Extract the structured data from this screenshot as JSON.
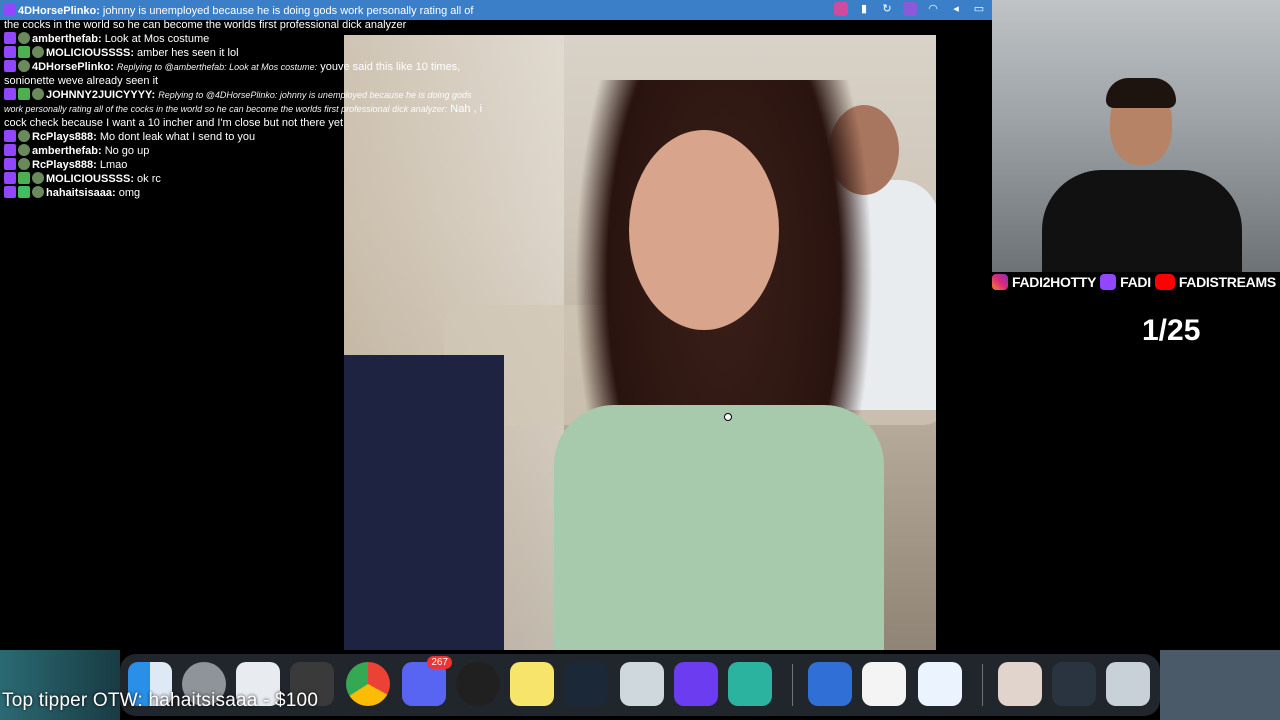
{
  "chat": {
    "messages": [
      {
        "user": "4DHorsePlinko:",
        "reply": "",
        "text": "johnny is unemployed because he is doing gods work personally rating all of the cocks in the world so he can become the worlds first professional dick analyzer"
      },
      {
        "user": "amberthefab:",
        "reply": "",
        "text": "Look at Mos costume"
      },
      {
        "user": "MOLICIOUSSSS:",
        "reply": "",
        "text": "amber hes seen it lol"
      },
      {
        "user": "4DHorsePlinko:",
        "reply": "Replying to @amberthefab: Look at Mos costume:",
        "text": "youve said this like 10 times, sonionette weve already seen it"
      },
      {
        "user": "JOHNNY2JUICYYYY:",
        "reply": "Replying to @4DHorsePlinko: johnny is unemployed because he is doing gods work personally rating all of the cocks in the world so he can become the worlds first professional dick analyzer:",
        "text": "Nah , i cock check because I want a 10 incher and I'm close but not there yet"
      },
      {
        "user": "RcPlays888:",
        "reply": "",
        "text": "Mo dont leak what I send to you"
      },
      {
        "user": "amberthefab:",
        "reply": "",
        "text": "No go up"
      },
      {
        "user": "RcPlays888:",
        "reply": "",
        "text": "Lmao"
      },
      {
        "user": "MOLICIOUSSSS:",
        "reply": "",
        "text": "ok rc"
      },
      {
        "user": "hahaitsisaaa:",
        "reply": "",
        "text": "omg"
      }
    ]
  },
  "socials": {
    "instagram": "FADI2HOTTY",
    "twitch": "FADI",
    "youtube": "FADISTREAMS"
  },
  "counter": "1/25",
  "tipper": "Top tipper OTW: hahaitsisaaa - $100",
  "dock": {
    "discord_badge": "267",
    "items": [
      "finder-icon",
      "system-settings-icon",
      "launchpad-icon",
      "final-cut-icon",
      "chrome-icon",
      "discord-icon",
      "obs-icon",
      "notes-icon",
      "steam-icon",
      "chat-app-icon",
      "app-grid-icon",
      "audio-app-icon",
      "app-icon-blue",
      "app-icon-pink",
      "app-icon-q",
      "folder-icon",
      "screenshot-icon",
      "trash-icon"
    ]
  },
  "colors": {
    "menubar": "#3b7fc8",
    "twitch": "#9146ff",
    "youtube": "#ff0000"
  }
}
